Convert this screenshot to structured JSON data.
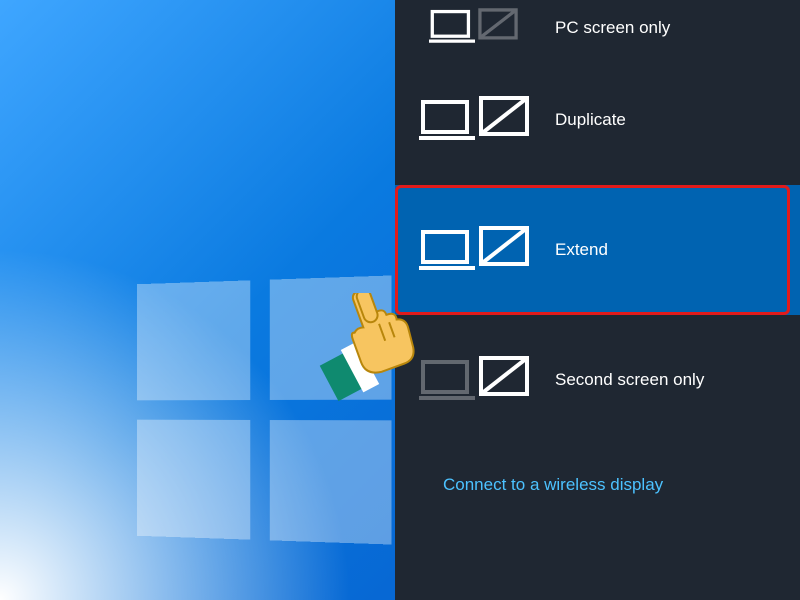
{
  "flyout": {
    "options": [
      {
        "id": "pc-only",
        "label": "PC screen only",
        "selected": false,
        "dim_laptop": false,
        "dim_monitor": true
      },
      {
        "id": "duplicate",
        "label": "Duplicate",
        "selected": false,
        "dim_laptop": false,
        "dim_monitor": false
      },
      {
        "id": "extend",
        "label": "Extend",
        "selected": true,
        "dim_laptop": false,
        "dim_monitor": false
      },
      {
        "id": "second-only",
        "label": "Second screen only",
        "selected": false,
        "dim_laptop": true,
        "dim_monitor": false
      }
    ],
    "connect_link": "Connect to a wireless display"
  },
  "annotation": {
    "highlight_option": "extend",
    "pointer": "pointing-hand"
  }
}
